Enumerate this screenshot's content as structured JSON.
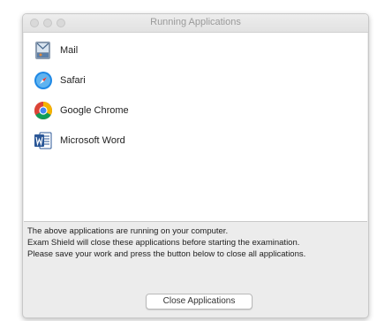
{
  "window": {
    "title": "Running Applications"
  },
  "applications": [
    {
      "name": "Mail",
      "icon": "mail-icon"
    },
    {
      "name": "Safari",
      "icon": "safari-icon"
    },
    {
      "name": "Google Chrome",
      "icon": "chrome-icon"
    },
    {
      "name": "Microsoft Word",
      "icon": "word-icon"
    }
  ],
  "message": {
    "line1": "The above applications are running on your computer.",
    "line2": "Exam Shield will close these applications before starting the examination.",
    "line3": "Please save your work and press the button below to close all applications."
  },
  "buttons": {
    "close_applications": "Close Applications"
  },
  "colors": {
    "window_bg": "#ececec",
    "list_bg": "#ffffff",
    "word_blue": "#2b5797",
    "safari_blue": "#1e88e5"
  }
}
